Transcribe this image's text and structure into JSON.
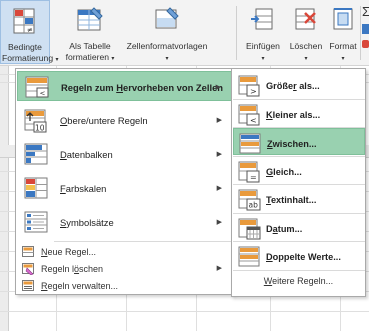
{
  "ribbon": {
    "buttons": [
      {
        "line1": "Bedingte",
        "line2": "Formatierung",
        "icon": "conditional-format-icon"
      },
      {
        "line1": "Als Tabelle",
        "line2": "formatieren",
        "icon": "format-as-table-icon"
      },
      {
        "line1": "Zellenformatvorlagen",
        "line2": "",
        "icon": "cell-styles-icon"
      },
      {
        "line1": "Einfügen",
        "line2": "",
        "icon": "insert-cells-icon"
      },
      {
        "line1": "Löschen",
        "line2": "",
        "icon": "delete-cells-icon"
      },
      {
        "line1": "Format",
        "line2": "",
        "icon": "format-cells-icon"
      }
    ],
    "right_glyph": "Σ"
  },
  "main_menu": {
    "items": [
      {
        "pre": "Regeln zum ",
        "u": "H",
        "post": "ervorheben von Zellen",
        "icon": "highlight-rules-icon",
        "has_submenu": true,
        "highlighted": true
      },
      {
        "pre": "",
        "u": "O",
        "post": "bere/untere Regeln",
        "icon": "top-bottom-rules-icon",
        "icon_text": "10",
        "has_submenu": true
      },
      {
        "pre": "",
        "u": "D",
        "post": "atenbalken",
        "icon": "data-bars-icon",
        "has_submenu": true
      },
      {
        "pre": "",
        "u": "F",
        "post": "arbskalen",
        "icon": "color-scales-icon",
        "has_submenu": true
      },
      {
        "pre": "",
        "u": "S",
        "post": "ymbolsätze",
        "icon": "icon-sets-icon",
        "has_submenu": true
      }
    ],
    "small_items": [
      {
        "pre": "",
        "u": "N",
        "post": "eue Regel...",
        "icon": "new-rule-icon"
      },
      {
        "pre": "Regeln l",
        "u": "ö",
        "post": "schen",
        "icon": "clear-rules-icon",
        "has_submenu": true
      },
      {
        "pre": "",
        "u": "R",
        "post": "egeln verwalten...",
        "icon": "manage-rules-icon"
      }
    ]
  },
  "sub_menu": {
    "items": [
      {
        "pre": "Größe",
        "u": "r",
        "post": " als...",
        "icon": "greater-than-icon",
        "symbol": ">"
      },
      {
        "pre": "",
        "u": "K",
        "post": "leiner als...",
        "icon": "less-than-icon",
        "symbol": "<"
      },
      {
        "pre": "",
        "u": "Z",
        "post": "wischen...",
        "icon": "between-icon",
        "symbol": "",
        "highlighted": true
      },
      {
        "pre": "",
        "u": "G",
        "post": "leich...",
        "icon": "equal-to-icon",
        "symbol": "="
      },
      {
        "pre": "",
        "u": "T",
        "post": "extinhalt...",
        "icon": "text-contains-icon",
        "symbol": "ab"
      },
      {
        "pre": "D",
        "u": "a",
        "post": "tum...",
        "icon": "date-occurring-icon",
        "symbol": ""
      },
      {
        "pre": "",
        "u": "D",
        "post": "oppelte Werte...",
        "icon": "duplicate-values-icon",
        "symbol": ""
      }
    ],
    "footer": {
      "pre": "",
      "u": "W",
      "post": "eitere Regeln..."
    }
  },
  "colors": {
    "highlight": "#99d1b0",
    "ribbon_active": "#cfe0f2",
    "red": "#d9473a",
    "blue": "#3b78c2",
    "orange": "#e99a3c"
  }
}
